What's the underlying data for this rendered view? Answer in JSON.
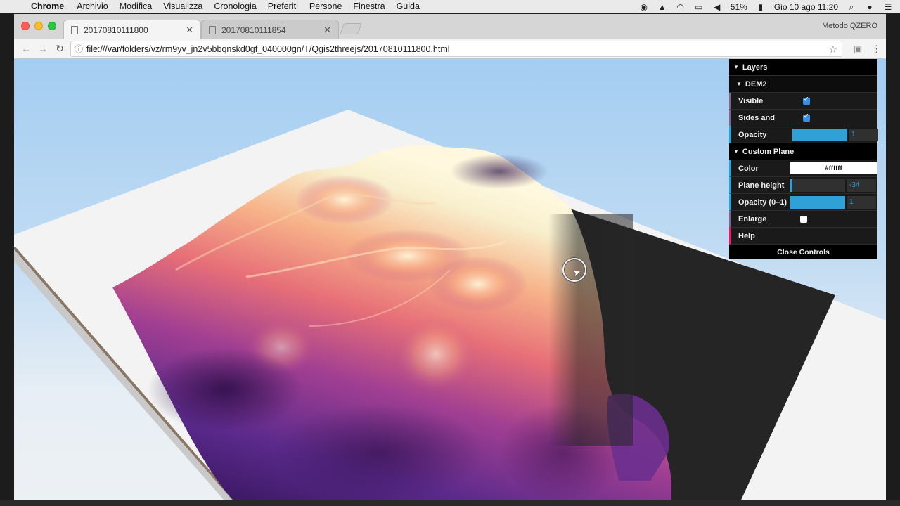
{
  "menubar": {
    "app_name": "Chrome",
    "menus": [
      "Archivio",
      "Modifica",
      "Visualizza",
      "Cronologia",
      "Preferiti",
      "Persone",
      "Finestra",
      "Guida"
    ],
    "battery": "51%",
    "datetime": "Gio 10 ago  11:20"
  },
  "browser": {
    "tabs": [
      {
        "title": "20170810111800",
        "active": true
      },
      {
        "title": "20170810111854",
        "active": false
      }
    ],
    "profile_name": "Metodo QZERO",
    "url": "file:///var/folders/vz/rm9yv_jn2v5bbqnskd0gf_040000gn/T/Qgis2threejs/20170810111800.html"
  },
  "gui": {
    "layers_folder": "Layers",
    "dem_folder": "DEM2",
    "visible_label": "Visible",
    "visible": true,
    "sides_label": "Sides and",
    "sides": true,
    "opacity_label": "Opacity",
    "opacity_value": "1",
    "opacity_fraction": 1.0,
    "custom_plane_folder": "Custom Plane",
    "color_label": "Color",
    "color_value": "#ffffff",
    "plane_height_label": "Plane height",
    "plane_height_value": "-34",
    "plane_height_fraction": 0.04,
    "plane_opacity_label": "Opacity (0–1)",
    "plane_opacity_value": "1",
    "plane_opacity_fraction": 1.0,
    "enlarge_label": "Enlarge",
    "enlarge": false,
    "help_label": "Help",
    "close_label": "Close Controls"
  },
  "colors": {
    "gui_accent": "#2fa1d6",
    "terrain_low": "#3b1860",
    "terrain_mid": "#c24a8a",
    "terrain_high": "#f7f1cf",
    "plane": "#f2f2f2"
  }
}
